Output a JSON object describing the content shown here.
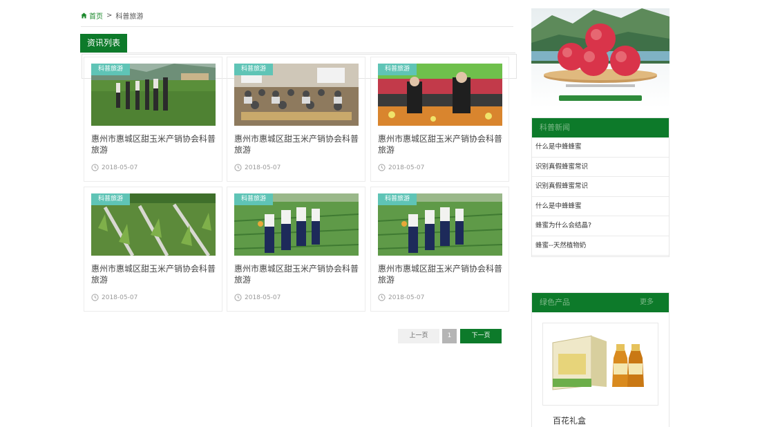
{
  "breadcrumb": {
    "home": "首页",
    "separator": ">",
    "current": "科普旅游"
  },
  "section": {
    "title": "资讯列表"
  },
  "articles": [
    {
      "tag": "科普旅游",
      "title": "惠州市惠城区甜玉米产销协会科普旅游",
      "date": "2018-05-07",
      "image": "group-field-photo"
    },
    {
      "tag": "科普旅游",
      "title": "惠州市惠城区甜玉米产销协会科普旅游",
      "date": "2018-05-07",
      "image": "meeting-room-photo"
    },
    {
      "tag": "科普旅游",
      "title": "惠州市惠城区甜玉米产销协会科普旅游",
      "date": "2018-05-07",
      "image": "fruit-stall-photo"
    },
    {
      "tag": "科普旅游",
      "title": "惠州市惠城区甜玉米产销协会科普旅游",
      "date": "2018-05-07",
      "image": "corn-field-photo"
    },
    {
      "tag": "科普旅游",
      "title": "惠州市惠城区甜玉米产销协会科普旅游",
      "date": "2018-05-07",
      "image": "onion-field-photo"
    },
    {
      "tag": "科普旅游",
      "title": "惠州市惠城区甜玉米产销协会科普旅游",
      "date": "2018-05-07",
      "image": "onion-field-photo"
    }
  ],
  "pagination": {
    "prev": "上一页",
    "current": "1",
    "next": "下一页"
  },
  "sidebar": {
    "banner_image": "apple-banner",
    "news": {
      "title": "科普新闻",
      "items": [
        "什么是中蜂蜂蜜",
        "识别真假蜂蜜常识",
        "识别真假蜂蜜常识",
        "什么是中蜂蜂蜜",
        "蜂蜜为什么会结晶?",
        "蜂蜜--天然植物奶"
      ]
    },
    "products": {
      "title": "绿色产品",
      "more": "更多",
      "first_product": "百花礼盒"
    }
  },
  "colors": {
    "brand_green": "#0d7a2a",
    "tag_teal": "#5fc4b6",
    "link_green": "#1e8a2e"
  }
}
